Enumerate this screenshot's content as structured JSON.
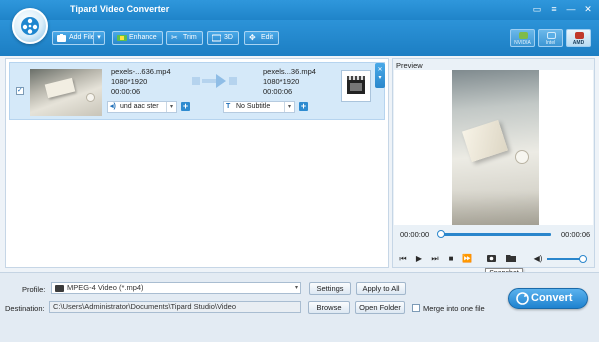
{
  "app": {
    "title": "Tipard Video Converter"
  },
  "toolbar": {
    "add_file": "Add File",
    "enhance": "Enhance",
    "trim": "Trim",
    "three_d": "3D",
    "edit": "Edit",
    "accel": [
      "NVIDIA",
      "Intel",
      "AMD"
    ],
    "active_accel": "AMD"
  },
  "file": {
    "checked": true,
    "source_name": "pexels-...636.mp4",
    "source_resolution": "1080*1920",
    "source_duration": "00:00:06",
    "target_name": "pexels...36.mp4",
    "target_resolution": "1080*1920",
    "target_duration": "00:00:06",
    "audio_track": "und aac ster",
    "subtitle": "No Subtitle"
  },
  "preview": {
    "label": "Preview",
    "time_current": "00:00:00",
    "time_total": "00:00:06",
    "playback_progress": 0,
    "volume_level": 0.9,
    "tooltip": "Snapshot"
  },
  "bottom": {
    "profile_label": "Profile:",
    "profile_value": "MPEG-4 Video (*.mp4)",
    "settings": "Settings",
    "apply_to_all": "Apply to All",
    "destination_label": "Destination:",
    "destination_value": "C:\\Users\\Administrator\\Documents\\Tipard Studio\\Video",
    "browse": "Browse",
    "open_folder": "Open Folder",
    "merge_label": "Merge into one file",
    "merge_checked": false,
    "convert": "Convert"
  },
  "colors": {
    "toolbar_blue": "#1f84c9",
    "accent_blue": "#2a86cc"
  }
}
